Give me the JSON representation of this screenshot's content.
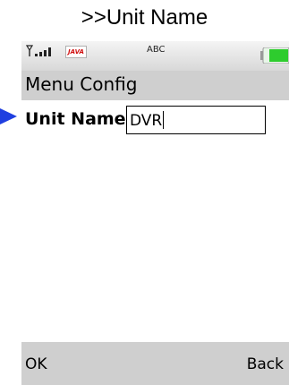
{
  "caption": ">>Unit Name",
  "status_bar": {
    "java_badge": "JAVA",
    "input_mode": "ABC",
    "battery_color": "#2ecc2e",
    "signal_icon": "signal-bars-icon"
  },
  "screen": {
    "title": "Menu Config"
  },
  "form": {
    "label": "Unit Name",
    "value": "DVR"
  },
  "softkeys": {
    "left": "OK",
    "right": "Back"
  },
  "colors": {
    "pointer": "#1f3fe0",
    "bar": "#cfcfcf"
  }
}
